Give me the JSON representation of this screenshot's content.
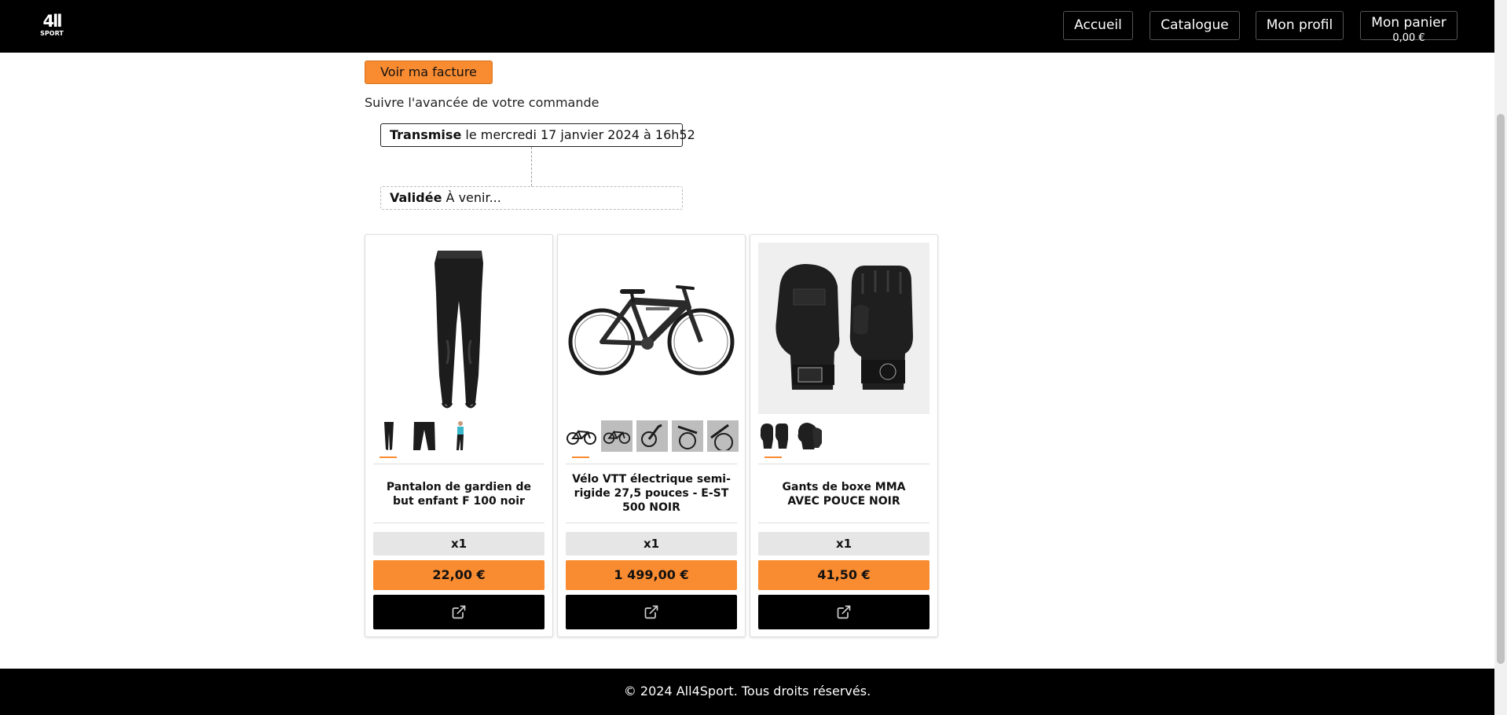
{
  "header": {
    "logo_main": "4ll",
    "logo_sub": "SPORT",
    "nav": {
      "home": "Accueil",
      "catalog": "Catalogue",
      "profile": "Mon profil",
      "cart": "Mon panier",
      "cart_total": "0,00 €"
    }
  },
  "order": {
    "invoice_button": "Voir ma facture",
    "follow_text": "Suivre l'avancée de votre commande",
    "steps": [
      {
        "status": "Transmise",
        "detail": "le mercredi 17 janvier 2024 à 16h52"
      },
      {
        "status": "Validée",
        "detail": "À venir..."
      }
    ]
  },
  "products": [
    {
      "title": "Pantalon de gardien de but enfant F 100 noir",
      "quantity": "x1",
      "price": "22,00 €",
      "image_icon": "pants-icon",
      "thumb_count": 3
    },
    {
      "title": "Vélo VTT électrique semi-rigide 27,5 pouces - E-ST 500 NOIR",
      "quantity": "x1",
      "price": "1 499,00 €",
      "image_icon": "bike-icon",
      "thumb_count": 5
    },
    {
      "title": "Gants de boxe MMA AVEC POUCE NOIR",
      "quantity": "x1",
      "price": "41,50 €",
      "image_icon": "gloves-icon",
      "thumb_count": 2
    }
  ],
  "footer": {
    "text": "© 2024 All4Sport. Tous droits réservés."
  },
  "colors": {
    "accent": "#f98b30",
    "header_bg": "#000000",
    "qty_bg": "#e6e6e6"
  }
}
